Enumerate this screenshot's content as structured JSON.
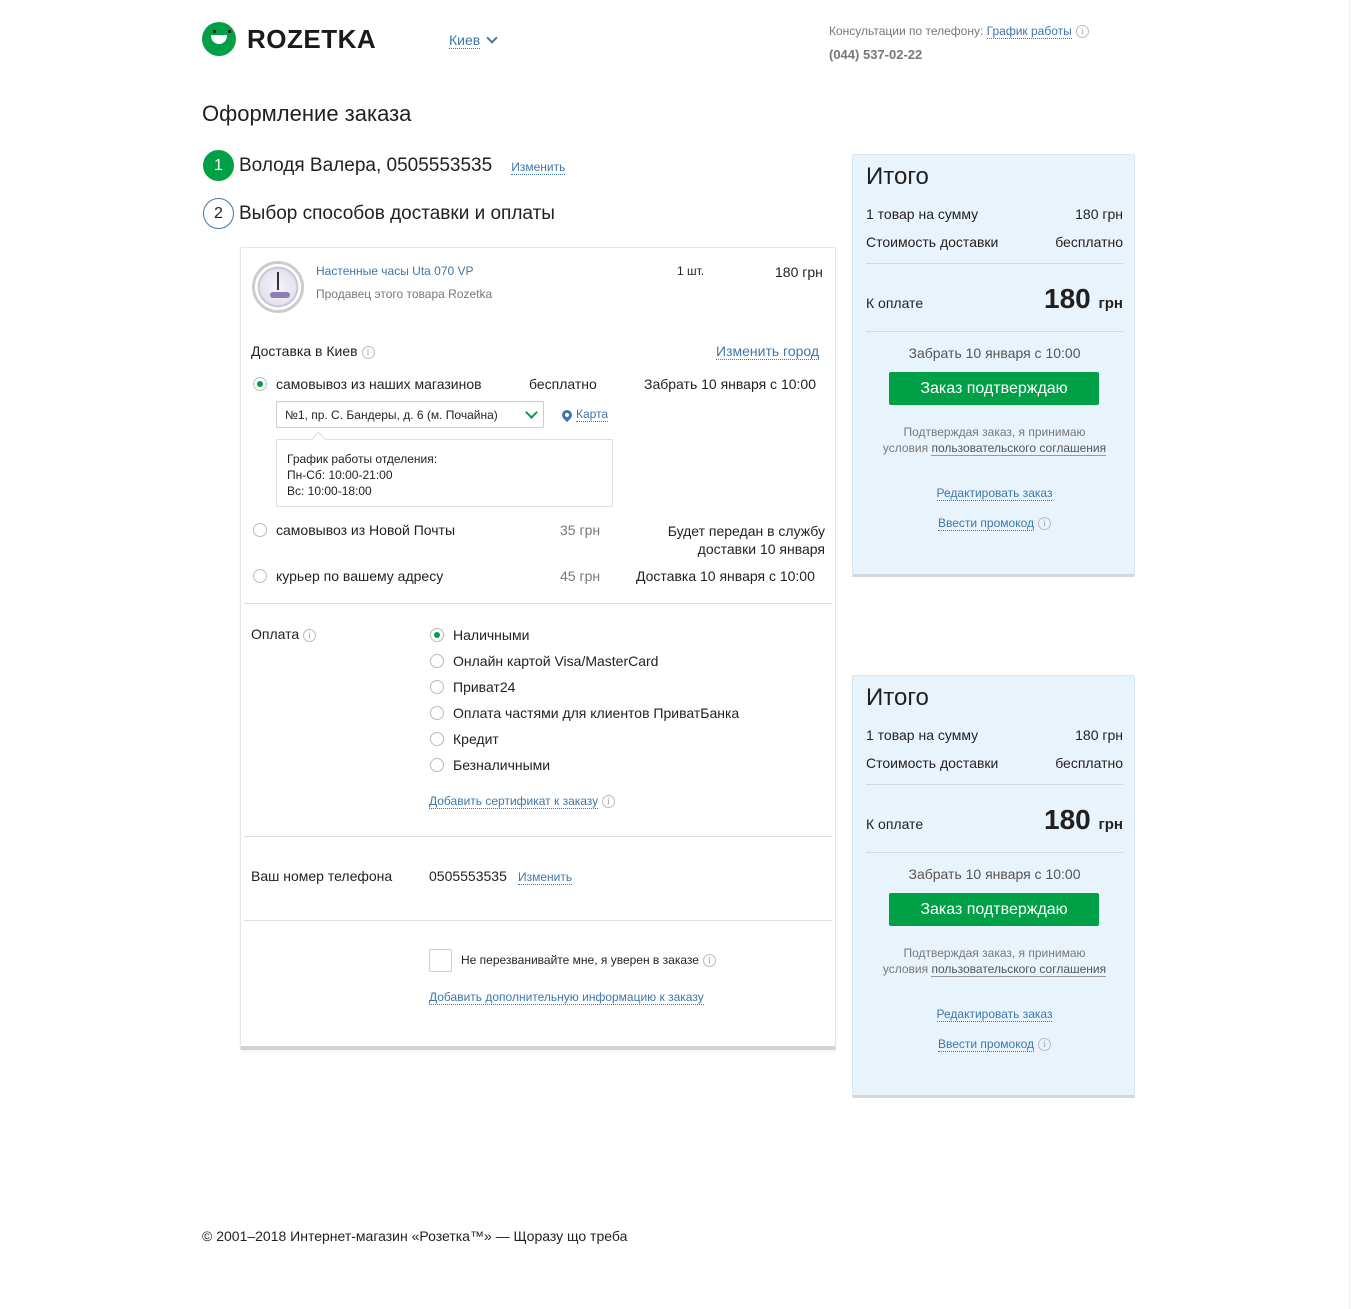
{
  "header": {
    "logo_text": "ROZETKA",
    "city": "Киев",
    "consult_label": "Консультации по телефону:",
    "schedule_link": "График работы",
    "phone": "(044) 537-02-22"
  },
  "page_title": "Оформление заказа",
  "steps": [
    {
      "num": "1",
      "label": "Володя Валера, 0505553535",
      "edit": "Изменить"
    },
    {
      "num": "2",
      "label": "Выбор способов доставки и оплаты"
    }
  ],
  "product": {
    "name": "Настенные часы Uta 070 VP",
    "seller": "Продавец этого товара  Rozetka",
    "qty": "1 шт.",
    "price": "180 грн"
  },
  "delivery": {
    "title": "Доставка в Киев",
    "change_city": "Изменить город",
    "options": [
      {
        "label": "самовывоз из наших магазинов",
        "price": "бесплатно",
        "info": "Забрать 10 января с 10:00",
        "selected": true
      },
      {
        "label": "самовывоз из Новой Почты",
        "price": "35 грн",
        "info": "Будет передан в службу доставки 10 января",
        "selected": false
      },
      {
        "label": "курьер по вашему адресу",
        "price": "45 грн",
        "info": "Доставка 10 января с 10:00",
        "selected": false
      }
    ],
    "store": "№1, пр. С. Бандеры, д. 6 (м. Почайна)",
    "map_link": "Карта",
    "hours_title": "График работы отделения:",
    "hours_weekdays": "Пн-Сб: 10:00-21:00",
    "hours_sunday": "Вс: 10:00-18:00"
  },
  "payment": {
    "title": "Оплата",
    "options": [
      {
        "label": "Наличными",
        "selected": true
      },
      {
        "label": "Онлайн картой Visa/MasterCard",
        "selected": false
      },
      {
        "label": "Приват24",
        "selected": false
      },
      {
        "label": "Оплата частями для клиентов ПриватБанка",
        "selected": false
      },
      {
        "label": "Кредит",
        "selected": false
      },
      {
        "label": "Безналичными",
        "selected": false
      }
    ],
    "certificate_link": "Добавить сертификат к заказу"
  },
  "phone_section": {
    "label": "Ваш номер телефона",
    "value": "0505553535",
    "edit": "Изменить"
  },
  "no_call": {
    "label": "Не перезванивайте мне, я уверен в заказе",
    "checked": false
  },
  "add_info_link": "Добавить дополнительную информацию к заказу",
  "summary": {
    "title": "Итого",
    "items_label": "1 товар на сумму",
    "items_value": "180 грн",
    "delivery_label": "Стоимость доставки",
    "delivery_value": "бесплатно",
    "total_label": "К оплате",
    "total_value": "180",
    "total_currency": "грн",
    "pickup": "Забрать 10 января с 10:00",
    "confirm_button": "Заказ подтверждаю",
    "agree_text_1": "Подтверждая заказ, я принимаю",
    "agree_text_2": "условия",
    "agree_link": "пользовательского соглашения",
    "edit_order": "Редактировать заказ",
    "promo": "Ввести промокод"
  },
  "footer": "© 2001–2018 Интернет-магазин «Розетка™» — Щоразу що треба",
  "colors": {
    "accent": "#00a046",
    "link": "#3e77aa",
    "summary_bg": "#e9f3fb"
  }
}
